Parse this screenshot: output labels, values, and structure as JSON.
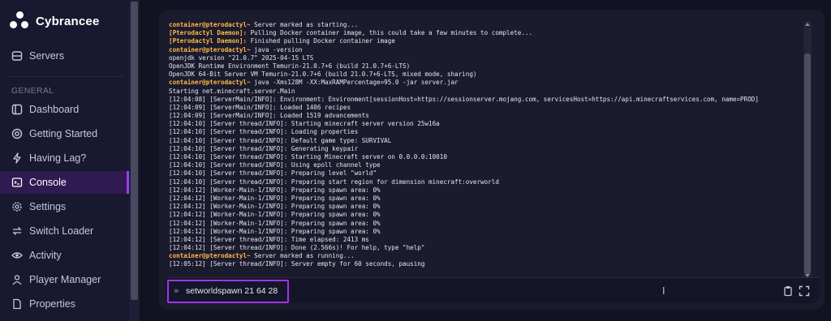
{
  "brand": {
    "name": "Cybrancee"
  },
  "nav": {
    "servers": "Servers",
    "section": "GENERAL",
    "items": [
      {
        "label": "Dashboard",
        "icon": "dashboard-icon"
      },
      {
        "label": "Getting Started",
        "icon": "life-ring-icon"
      },
      {
        "label": "Having Lag?",
        "icon": "bolt-icon"
      },
      {
        "label": "Console",
        "icon": "terminal-icon",
        "active": true
      },
      {
        "label": "Settings",
        "icon": "gear-icon"
      },
      {
        "label": "Switch Loader",
        "icon": "switch-icon"
      },
      {
        "label": "Activity",
        "icon": "eye-icon"
      },
      {
        "label": "Player Manager",
        "icon": "user-icon"
      },
      {
        "label": "Properties",
        "icon": "document-icon"
      }
    ]
  },
  "colors": {
    "accent": "#a233e8",
    "active_bg": "#301a52",
    "prompt": "#ffb84a"
  },
  "console": {
    "lines": [
      {
        "prefix": "container@pterodactyl~",
        "text": " Server marked as starting..."
      },
      {
        "prefix": "[Pterodactyl Daemon]:",
        "text": " Pulling Docker container image, this could take a few minutes to complete..."
      },
      {
        "prefix": "[Pterodactyl Daemon]:",
        "text": " Finished pulling Docker container image"
      },
      {
        "prefix": "container@pterodactyl~",
        "text": " java -version"
      },
      {
        "prefix": "",
        "text": "openjdk version \"21.0.7\" 2025-04-15 LTS"
      },
      {
        "prefix": "",
        "text": "OpenJDK Runtime Environment Temurin-21.0.7+6 (build 21.0.7+6-LTS)"
      },
      {
        "prefix": "",
        "text": "OpenJDK 64-Bit Server VM Temurin-21.0.7+6 (build 21.0.7+6-LTS, mixed mode, sharing)"
      },
      {
        "prefix": "container@pterodactyl~",
        "text": " java -Xms128M -XX:MaxRAMPercentage=95.0 -jar server.jar"
      },
      {
        "prefix": "",
        "text": "Starting net.minecraft.server.Main"
      },
      {
        "prefix": "",
        "text": "[12:04:08] [ServerMain/INFO]: Environment: Environment[sessionHost=https://sessionserver.mojang.com, servicesHost=https://api.minecraftservices.com, name=PROD]"
      },
      {
        "prefix": "",
        "text": "[12:04:09] [ServerMain/INFO]: Loaded 1406 recipes"
      },
      {
        "prefix": "",
        "text": "[12:04:09] [ServerMain/INFO]: Loaded 1519 advancements"
      },
      {
        "prefix": "",
        "text": "[12:04:10] [Server thread/INFO]: Starting minecraft server version 25w16a"
      },
      {
        "prefix": "",
        "text": "[12:04:10] [Server thread/INFO]: Loading properties"
      },
      {
        "prefix": "",
        "text": "[12:04:10] [Server thread/INFO]: Default game type: SURVIVAL"
      },
      {
        "prefix": "",
        "text": "[12:04:10] [Server thread/INFO]: Generating keypair"
      },
      {
        "prefix": "",
        "text": "[12:04:10] [Server thread/INFO]: Starting Minecraft server on 0.0.0.0:10010"
      },
      {
        "prefix": "",
        "text": "[12:04:10] [Server thread/INFO]: Using epoll channel type"
      },
      {
        "prefix": "",
        "text": "[12:04:10] [Server thread/INFO]: Preparing level \"world\""
      },
      {
        "prefix": "",
        "text": "[12:04:10] [Server thread/INFO]: Preparing start region for dimension minecraft:overworld"
      },
      {
        "prefix": "",
        "text": "[12:04:12] [Worker-Main-1/INFO]: Preparing spawn area: 0%"
      },
      {
        "prefix": "",
        "text": "[12:04:12] [Worker-Main-1/INFO]: Preparing spawn area: 0%"
      },
      {
        "prefix": "",
        "text": "[12:04:12] [Worker-Main-1/INFO]: Preparing spawn area: 0%"
      },
      {
        "prefix": "",
        "text": "[12:04:12] [Worker-Main-1/INFO]: Preparing spawn area: 0%"
      },
      {
        "prefix": "",
        "text": "[12:04:12] [Worker-Main-1/INFO]: Preparing spawn area: 0%"
      },
      {
        "prefix": "",
        "text": "[12:04:12] [Worker-Main-1/INFO]: Preparing spawn area: 0%"
      },
      {
        "prefix": "",
        "text": "[12:04:12] [Server thread/INFO]: Time elapsed: 2413 ms"
      },
      {
        "prefix": "",
        "text": "[12:04:12] [Server thread/INFO]: Done (2.566s)! For help, type \"help\""
      },
      {
        "prefix": "container@pterodactyl~",
        "text": " Server marked as running..."
      },
      {
        "prefix": "",
        "text": "[12:05:12] [Server thread/INFO]: Server empty for 60 seconds, pausing"
      }
    ],
    "input_value": "setworldspawn 21 64 28",
    "prompt_symbol": "»"
  }
}
